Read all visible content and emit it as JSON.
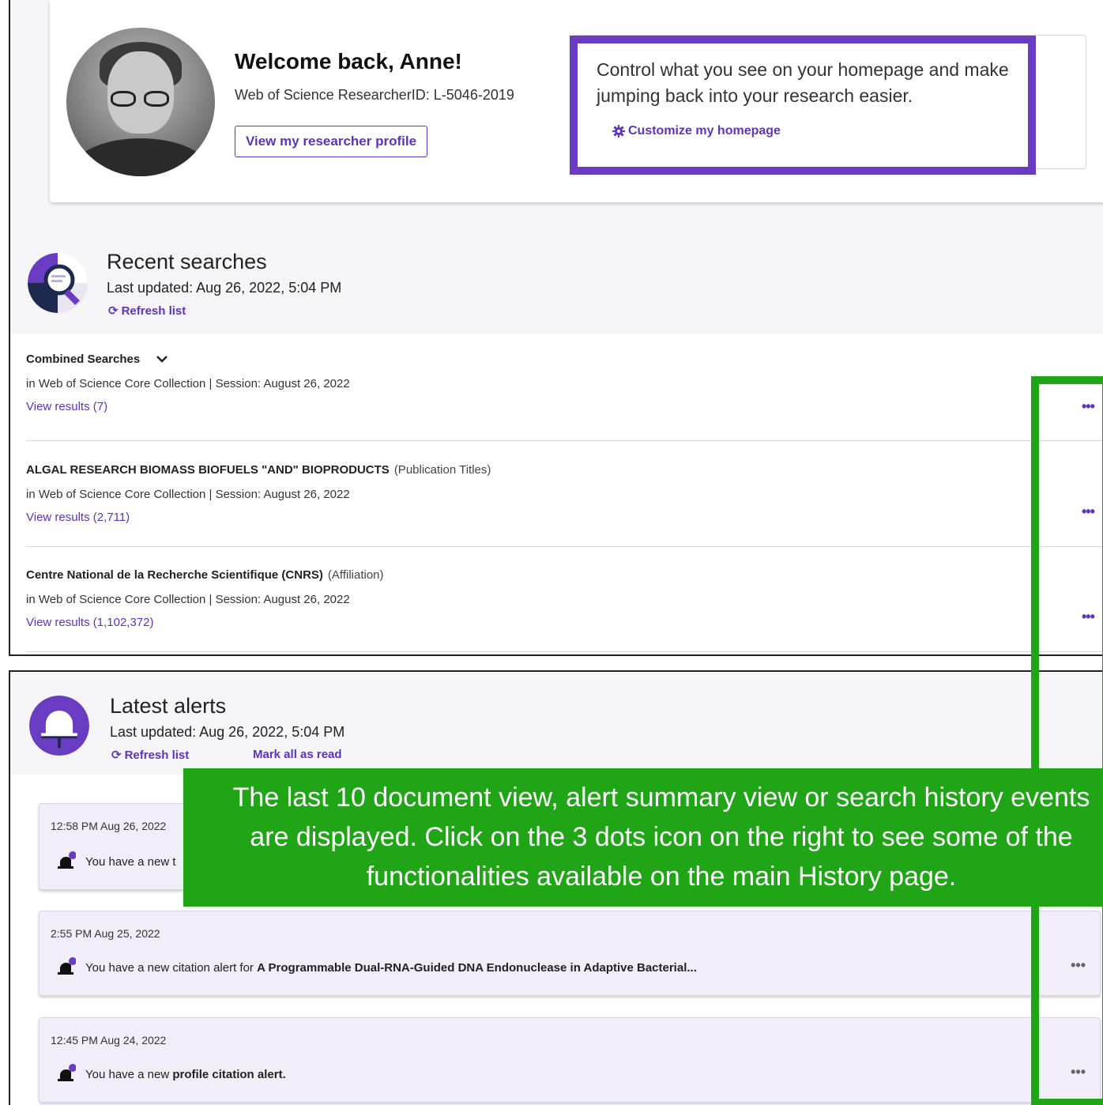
{
  "welcome": {
    "title": "Welcome back, Anne!",
    "researcher_id": "Web of Science ResearcherID: L-5046-2019",
    "profile_button": "View my researcher profile",
    "customize_text": "Control what you see on your homepage and make jumping back into your research easier.",
    "customize_link": "Customize my homepage"
  },
  "recent_searches": {
    "title": "Recent searches",
    "updated": "Last updated: Aug 26, 2022, 5:04 PM",
    "refresh": "Refresh list",
    "items": [
      {
        "title": "Combined Searches",
        "type": "",
        "meta": "in Web of Science Core Collection | Session: August 26, 2022",
        "link": "View results (7)"
      },
      {
        "title": "ALGAL RESEARCH BIOMASS BIOFUELS \"AND\" BIOPRODUCTS",
        "type": "(Publication Titles)",
        "meta": "in Web of Science Core Collection | Session: August 26, 2022",
        "link": "View results (2,711)"
      },
      {
        "title": "Centre National de la Recherche Scientifique (CNRS)",
        "type": "(Affiliation)",
        "meta": "in Web of Science Core Collection | Session: August 26, 2022",
        "link": "View results (1,102,372)"
      }
    ]
  },
  "latest_alerts": {
    "title": "Latest alerts",
    "updated": "Last updated: Aug 26, 2022, 5:04 PM",
    "refresh": "Refresh list",
    "mark_read": "Mark all as read",
    "items": [
      {
        "time": "12:58 PM Aug 26, 2022",
        "prefix": "You have a new t",
        "bold": ""
      },
      {
        "time": "2:55 PM Aug 25, 2022",
        "prefix": "You have a new citation alert for",
        "bold": "A Programmable Dual-RNA-Guided DNA Endonuclease in Adaptive Bacterial..."
      },
      {
        "time": "12:45 PM Aug 24, 2022",
        "prefix": "You have a new",
        "bold": "profile citation alert."
      }
    ]
  },
  "callout": {
    "text": "The last 10 document view, alert summary view or search history events are displayed. Click on the 3 dots icon on the right to see some of the functionalities available on the main History page."
  },
  "icons": {
    "more": "•••",
    "more_alert": "•••"
  },
  "colors": {
    "accent": "#5e33bf",
    "highlight_purple": "#6a3cc2",
    "highlight_green": "#1fa516",
    "alert_bg": "#f1eefa"
  }
}
